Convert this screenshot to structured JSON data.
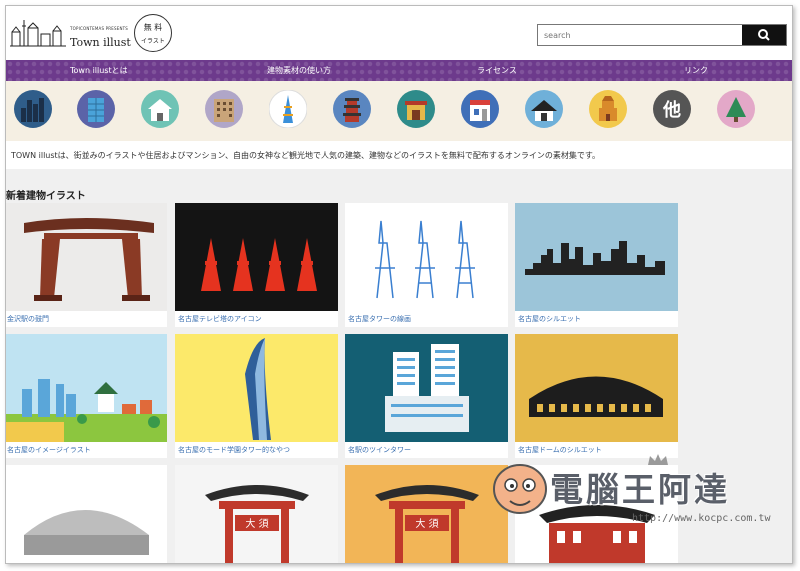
{
  "header": {
    "presents": "TOPICONTEMAS PRESENTS",
    "site_title": "Town illust",
    "badge_line1": "無 料",
    "badge_line2": "イラスト"
  },
  "search": {
    "placeholder": "search"
  },
  "nav": {
    "items": [
      {
        "label": "Town illustとは"
      },
      {
        "label": "建物素材の使い方"
      },
      {
        "label": "ライセンス"
      },
      {
        "label": "リンク"
      }
    ]
  },
  "category_icons": [
    "skyline-icon",
    "office-tower-icon",
    "house-icon",
    "apartment-icon",
    "tokyo-tower-icon",
    "pagoda-icon",
    "shrine-gate-icon",
    "shop-icon",
    "japanese-house-icon",
    "castle-icon",
    "other-icon",
    "tree-icon"
  ],
  "category_other_char": "他",
  "intro": {
    "text": "TOWN illustは、街並みのイラストや住居およびマンション、自由の女神など観光地で人気の建築、建物などのイラストを無料で配布するオンラインの素材集です。"
  },
  "section": {
    "title": "新着建物イラスト"
  },
  "cards": [
    {
      "label": "金沢駅の鼓門"
    },
    {
      "label": "名古屋テレビ塔のアイコン"
    },
    {
      "label": "名古屋タワーの線画"
    },
    {
      "label": "名古屋のシルエット"
    },
    {
      "label": "名古屋のイメージイラスト"
    },
    {
      "label": "名古屋のモード学園タワー的なやつ"
    },
    {
      "label": "名駅のツインタワー"
    },
    {
      "label": "名古屋ドームのシルエット"
    },
    {
      "label": ""
    },
    {
      "label": ""
    },
    {
      "label": ""
    },
    {
      "label": ""
    }
  ],
  "gate_sign": "大 須",
  "watermark": {
    "text": "電腦王阿達",
    "url": "http://www.kocpc.com.tw"
  },
  "colors": {
    "nav_purple": "#6d3a8c",
    "icon_strip_bg": "#f5efe3",
    "link_blue": "#3a6fb0",
    "search_button": "#111111"
  }
}
